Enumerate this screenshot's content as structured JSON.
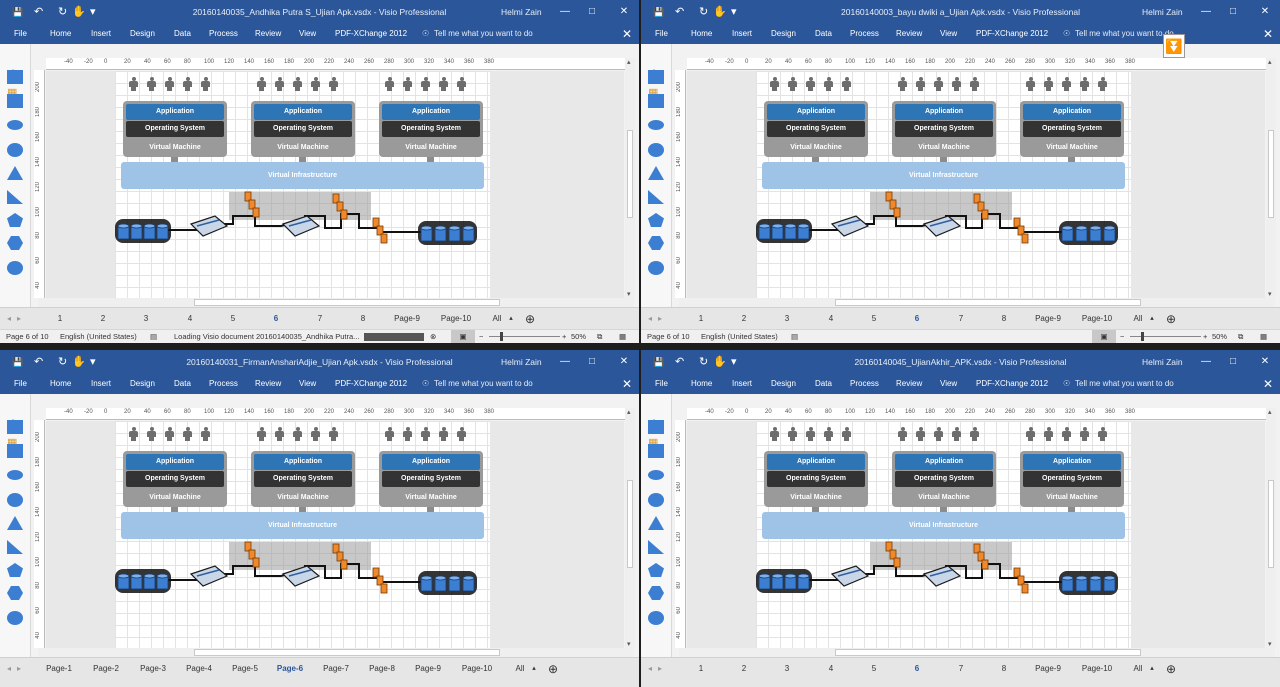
{
  "windows": [
    {
      "title": "20160140035_Andhika Putra S_Ujian Apk.vsdx - Visio Professional",
      "user": "Helmi Zain",
      "page_tabs": [
        "1",
        "2",
        "3",
        "4",
        "5",
        "6",
        "7",
        "8",
        "Page-9",
        "Page-10",
        "All"
      ],
      "active_tab_index": 5,
      "status": {
        "page": "Page 6 of 10",
        "language": "English (United States)",
        "loading": "Loading Visio document 20160140035_Andhika Putra...",
        "zoom": "50%"
      },
      "pdf_icon": false
    },
    {
      "title": "20160140003_bayu dwiki a_Ujian Apk.vsdx - Visio Professional",
      "user": "Helmi Zain",
      "page_tabs": [
        "1",
        "2",
        "3",
        "4",
        "5",
        "6",
        "7",
        "8",
        "Page-9",
        "Page-10",
        "All"
      ],
      "active_tab_index": 5,
      "status": {
        "page": "Page 6 of 10",
        "language": "English (United States)",
        "loading": "",
        "zoom": "50%"
      },
      "pdf_icon": true
    },
    {
      "title": "20160140031_FirmanAnshariAdjie_Ujian Apk.vsdx - Visio Professional",
      "user": "Helmi Zain",
      "page_tabs": [
        "Page-1",
        "Page-2",
        "Page-3",
        "Page-4",
        "Page-5",
        "Page-6",
        "Page-7",
        "Page-8",
        "Page-9",
        "Page-10",
        "All"
      ],
      "active_tab_index": 5,
      "status": null,
      "pdf_icon": false
    },
    {
      "title": "20160140045_UjianAkhir_APK.vsdx - Visio Professional",
      "user": "Helmi Zain",
      "page_tabs": [
        "1",
        "2",
        "3",
        "4",
        "5",
        "6",
        "7",
        "8",
        "Page-9",
        "Page-10",
        "All"
      ],
      "active_tab_index": 5,
      "status": null,
      "pdf_icon": false
    }
  ],
  "ribbon_tabs": [
    "File",
    "Home",
    "Insert",
    "Design",
    "Data",
    "Process",
    "Review",
    "View",
    "PDF-XChange 2012"
  ],
  "tell_me": "Tell me what you want to do",
  "ruler_h": [
    "-40",
    "-20",
    "0",
    "20",
    "40",
    "60",
    "80",
    "100",
    "120",
    "140",
    "160",
    "180",
    "200",
    "220",
    "240",
    "260",
    "280",
    "300",
    "320",
    "340",
    "360",
    "380"
  ],
  "ruler_v": [
    "200",
    "180",
    "160",
    "140",
    "120",
    "100",
    "80",
    "60",
    "40"
  ],
  "diagram": {
    "application": "Application",
    "operating_system": "Operating System",
    "virtual_machine": "Virtual Machine",
    "virtual_infrastructure": "Virtual Infrastructure"
  },
  "colors": {
    "title_bar": "#2b579a",
    "app_box": "#2e75b6",
    "os_box": "#333333",
    "vm_box": "#9a9a9a",
    "infra": "#9ec3e6",
    "database": "#3b7ed2",
    "server": "#f0892b"
  }
}
